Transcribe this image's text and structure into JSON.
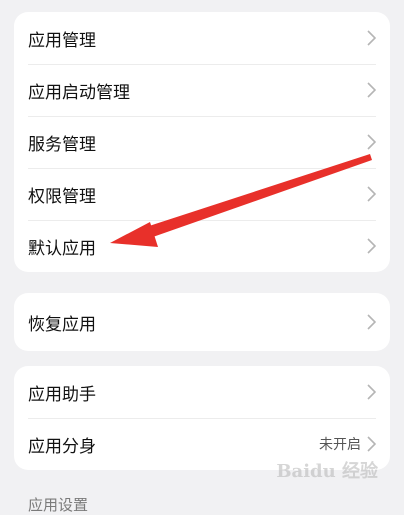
{
  "cards": [
    {
      "items": [
        {
          "label": "应用管理"
        },
        {
          "label": "应用启动管理"
        },
        {
          "label": "服务管理"
        },
        {
          "label": "权限管理"
        },
        {
          "label": "默认应用"
        }
      ]
    },
    {
      "items": [
        {
          "label": "恢复应用"
        }
      ]
    },
    {
      "items": [
        {
          "label": "应用助手"
        },
        {
          "label": "应用分身",
          "value": "未开启"
        }
      ]
    }
  ],
  "section_title": "应用设置",
  "watermark": "Baidu 经验",
  "colors": {
    "annotation_arrow": "#e8302a",
    "card_bg": "#ffffff",
    "page_bg": "#f1f1f3"
  },
  "icons": {
    "row_chevron": "chevron-right-icon"
  }
}
